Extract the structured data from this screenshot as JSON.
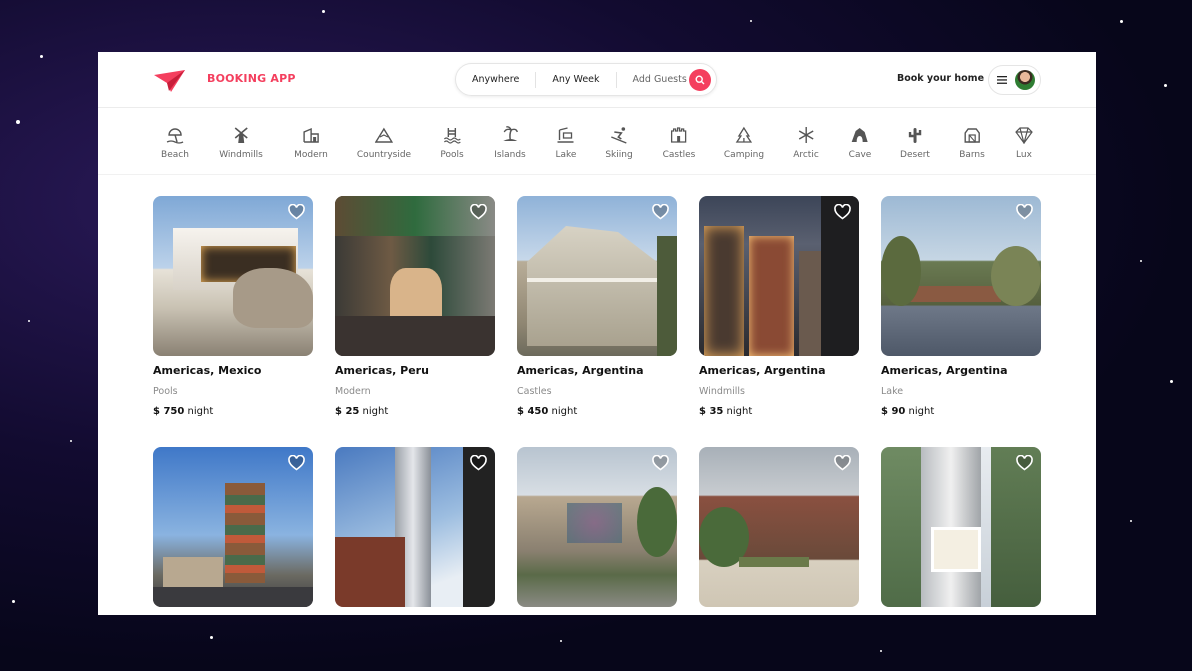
{
  "brand": {
    "name": "BOOKING APP",
    "color": "#f43f5e",
    "logo_icon": "paper-plane-icon"
  },
  "search": {
    "where": "Anywhere",
    "when": "Any Week",
    "guests": "Add Guests",
    "icon": "search-icon"
  },
  "header": {
    "book_home": "Book your home",
    "menu_icon": "hamburger-icon"
  },
  "categories": [
    {
      "label": "Beach",
      "icon": "beach-icon"
    },
    {
      "label": "Windmills",
      "icon": "windmill-icon"
    },
    {
      "label": "Modern",
      "icon": "modern-icon"
    },
    {
      "label": "Countryside",
      "icon": "mountain-icon"
    },
    {
      "label": "Pools",
      "icon": "pool-icon"
    },
    {
      "label": "Islands",
      "icon": "island-icon"
    },
    {
      "label": "Lake",
      "icon": "lake-icon"
    },
    {
      "label": "Skiing",
      "icon": "skiing-icon"
    },
    {
      "label": "Castles",
      "icon": "castle-icon"
    },
    {
      "label": "Camping",
      "icon": "camping-icon"
    },
    {
      "label": "Arctic",
      "icon": "snowflake-icon"
    },
    {
      "label": "Cave",
      "icon": "cave-icon"
    },
    {
      "label": "Desert",
      "icon": "cactus-icon"
    },
    {
      "label": "Barns",
      "icon": "barn-icon"
    },
    {
      "label": "Lux",
      "icon": "diamond-icon"
    }
  ],
  "listings": [
    {
      "location": "Americas, Mexico",
      "category": "Pools",
      "price": "$ 750",
      "unit": "night"
    },
    {
      "location": "Americas, Peru",
      "category": "Modern",
      "price": "$ 25",
      "unit": "night"
    },
    {
      "location": "Americas, Argentina",
      "category": "Castles",
      "price": "$ 450",
      "unit": "night"
    },
    {
      "location": "Americas, Argentina",
      "category": "Windmills",
      "price": "$ 35",
      "unit": "night"
    },
    {
      "location": "Americas, Argentina",
      "category": "Lake",
      "price": "$ 90",
      "unit": "night"
    },
    {
      "location": "",
      "category": "",
      "price": "",
      "unit": ""
    },
    {
      "location": "",
      "category": "",
      "price": "",
      "unit": ""
    },
    {
      "location": "",
      "category": "",
      "price": "",
      "unit": ""
    },
    {
      "location": "",
      "category": "",
      "price": "",
      "unit": ""
    },
    {
      "location": "",
      "category": "",
      "price": "",
      "unit": ""
    }
  ]
}
